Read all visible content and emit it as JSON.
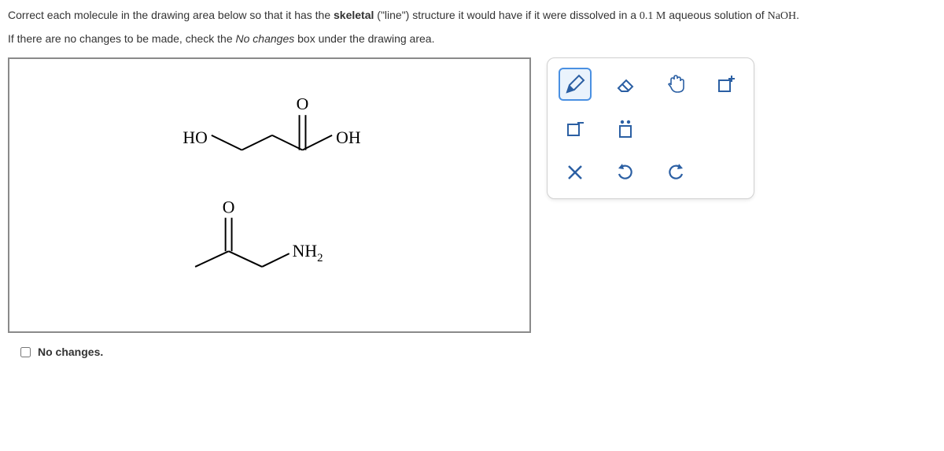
{
  "question": {
    "part1_a": "Correct each molecule in the drawing area below so that it has the ",
    "part1_b": "skeletal",
    "part1_c": " (\"line\") structure it would have if it were dissolved in a ",
    "part1_d": "0.1 M",
    "part1_e": " aqueous solution of ",
    "part1_f": "NaOH",
    "part1_g": ".",
    "part2_a": "If there are no changes to be made, check the ",
    "part2_b": "No changes",
    "part2_c": " box under the drawing area."
  },
  "no_changes_label": "No changes.",
  "molecule_labels": {
    "ho_left": "HO",
    "o_top1": "O",
    "oh_right": "OH",
    "o_top2": "O",
    "nh2": "NH",
    "nh2_sub": "2"
  },
  "tools": {
    "pencil": "pencil-icon",
    "eraser": "eraser-icon",
    "hand": "hand-icon",
    "plus_charge": "plus-charge-icon",
    "minus_charge": "minus-charge-icon",
    "lone_pair": "lone-pair-icon",
    "clear": "clear-icon",
    "undo": "undo-icon",
    "redo": "redo-icon"
  }
}
